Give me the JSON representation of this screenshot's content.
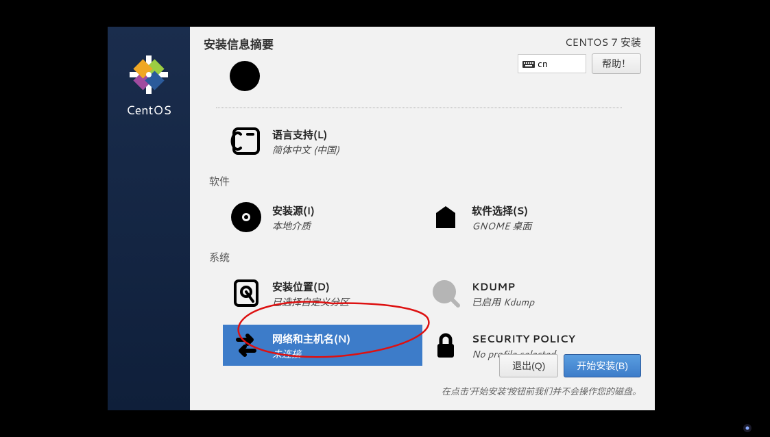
{
  "sidebar": {
    "brand": "CentOS"
  },
  "header": {
    "page_title": "安装信息摘要",
    "product": "CENTOS 7 安装",
    "keyboard_layout": "cn",
    "help_label": "帮助！"
  },
  "sections": {
    "software": "软件",
    "system": "系统"
  },
  "spokes": {
    "language": {
      "title": "语言支持(L)",
      "status": "简体中文 (中国)"
    },
    "install_source": {
      "title": "安装源(I)",
      "status": "本地介质"
    },
    "software_selection": {
      "title": "软件选择(S)",
      "status": "GNOME 桌面"
    },
    "install_destination": {
      "title": "安装位置(D)",
      "status": "已选择自定义分区"
    },
    "kdump": {
      "title": "KDUMP",
      "status": "已启用 Kdump"
    },
    "network": {
      "title": "网络和主机名(N)",
      "status": "未连接"
    },
    "security_policy": {
      "title": "SECURITY POLICY",
      "status": "No profile selected"
    }
  },
  "footer": {
    "quit_label": "退出(Q)",
    "begin_label": "开始安装(B)",
    "hint": "在点击'开始安装'按钮前我们并不会操作您的磁盘。"
  }
}
